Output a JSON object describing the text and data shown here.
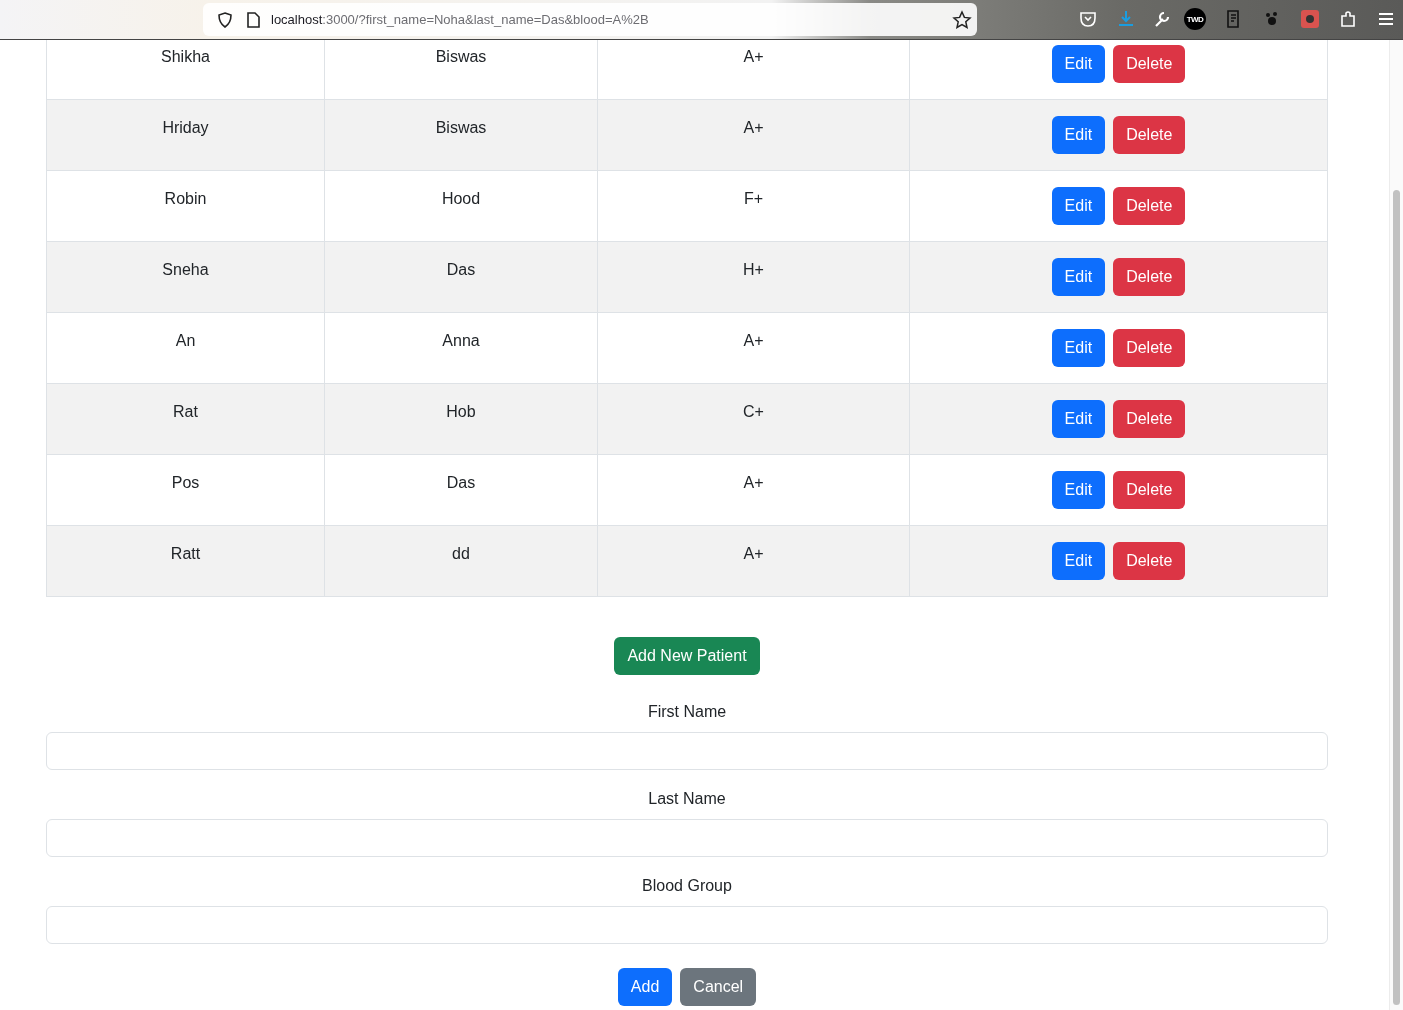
{
  "browser": {
    "url_host": "localhost",
    "url_path": ":3000/?first_name=Noha&last_name=Das&blood=A%2B",
    "badge": "TWD"
  },
  "patients": [
    {
      "first_name": "Shikha",
      "last_name": "Biswas",
      "blood": "A+",
      "edit": "Edit",
      "delete": "Delete"
    },
    {
      "first_name": "Hriday",
      "last_name": "Biswas",
      "blood": "A+",
      "edit": "Edit",
      "delete": "Delete"
    },
    {
      "first_name": "Robin",
      "last_name": "Hood",
      "blood": "F+",
      "edit": "Edit",
      "delete": "Delete"
    },
    {
      "first_name": "Sneha",
      "last_name": "Das",
      "blood": "H+",
      "edit": "Edit",
      "delete": "Delete"
    },
    {
      "first_name": "An",
      "last_name": "Anna",
      "blood": "A+",
      "edit": "Edit",
      "delete": "Delete"
    },
    {
      "first_name": "Rat",
      "last_name": "Hob",
      "blood": "C+",
      "edit": "Edit",
      "delete": "Delete"
    },
    {
      "first_name": "Pos",
      "last_name": "Das",
      "blood": "A+",
      "edit": "Edit",
      "delete": "Delete"
    },
    {
      "first_name": "Ratt",
      "last_name": "dd",
      "blood": "A+",
      "edit": "Edit",
      "delete": "Delete"
    }
  ],
  "add_button": "Add New Patient",
  "form": {
    "fields": [
      {
        "label": "First Name"
      },
      {
        "label": "Last Name"
      },
      {
        "label": "Blood Group"
      }
    ],
    "buttons": [
      {
        "kind": "primary",
        "label": "Add"
      },
      {
        "kind": "secondary",
        "label": "Cancel"
      }
    ]
  }
}
